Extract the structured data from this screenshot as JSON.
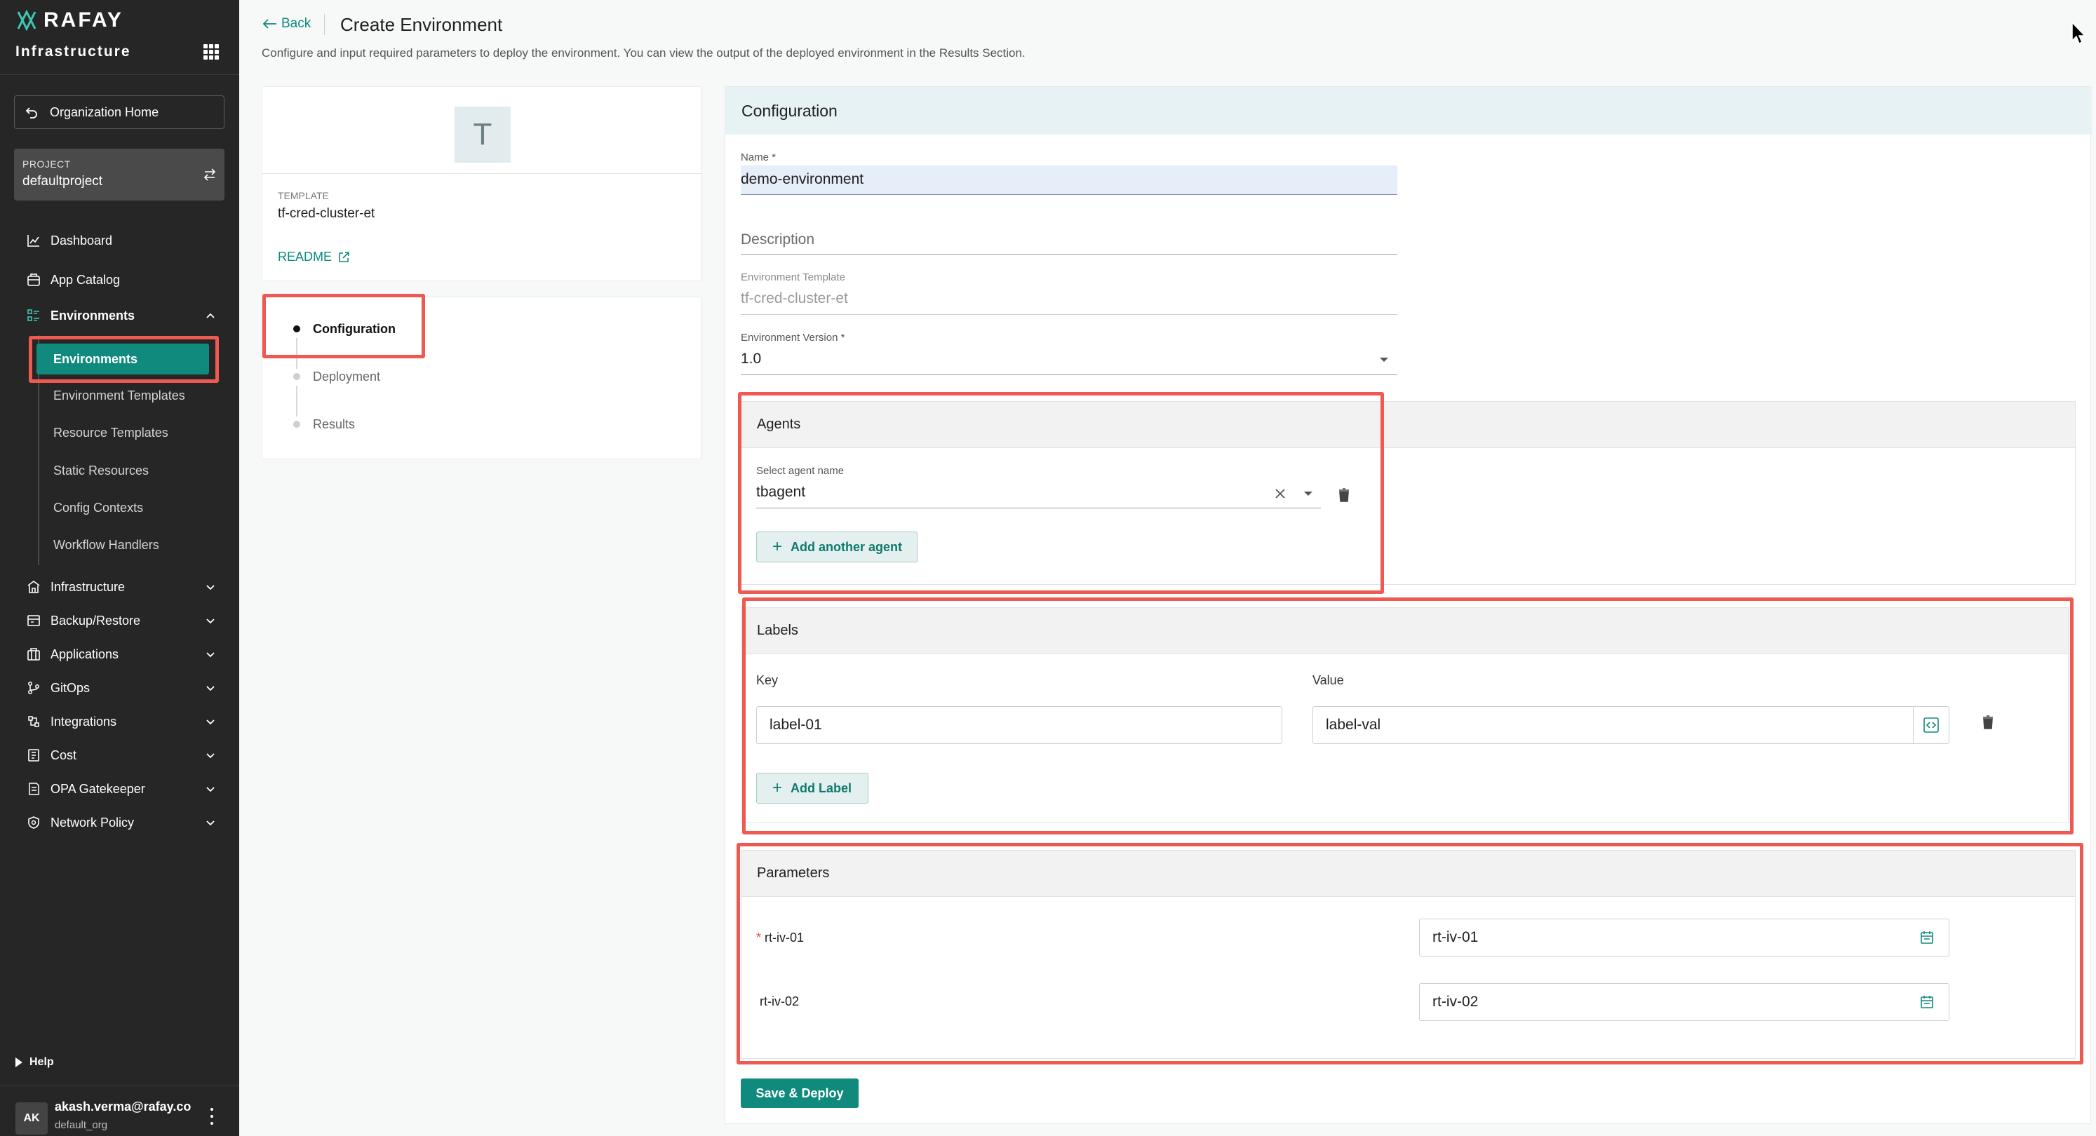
{
  "brand": {
    "name": "RAFAY",
    "section": "Infrastructure"
  },
  "sidebar": {
    "org_home": "Organization Home",
    "project": {
      "kicker": "PROJECT",
      "name": "defaultproject"
    },
    "nav": [
      {
        "label": "Dashboard",
        "icon": "chart-icon"
      },
      {
        "label": "App Catalog",
        "icon": "catalog-icon"
      },
      {
        "label": "Environments",
        "icon": "environments-icon"
      },
      {
        "label": "Infrastructure",
        "icon": "infrastructure-icon"
      },
      {
        "label": "Backup/Restore",
        "icon": "backup-icon"
      },
      {
        "label": "Applications",
        "icon": "applications-icon"
      },
      {
        "label": "GitOps",
        "icon": "gitops-icon"
      },
      {
        "label": "Integrations",
        "icon": "integrations-icon"
      },
      {
        "label": "Cost",
        "icon": "cost-icon"
      },
      {
        "label": "OPA Gatekeeper",
        "icon": "opa-icon"
      },
      {
        "label": "Network Policy",
        "icon": "network-policy-icon"
      }
    ],
    "env_sub": [
      "Environments",
      "Environment Templates",
      "Resource Templates",
      "Static Resources",
      "Config Contexts",
      "Workflow Handlers"
    ],
    "help": "Help",
    "user": {
      "initials": "AK",
      "email": "akash.verma@rafay.co",
      "org": "default_org"
    }
  },
  "header": {
    "back": "Back",
    "title": "Create Environment",
    "description": "Configure and input required parameters to deploy the environment. You can view the output of the deployed environment in the Results Section."
  },
  "template_card": {
    "letter": "T",
    "kicker": "TEMPLATE",
    "name": "tf-cred-cluster-et",
    "readme": "README"
  },
  "steps": [
    "Configuration",
    "Deployment",
    "Results"
  ],
  "config": {
    "heading": "Configuration",
    "name_label": "Name *",
    "name_value": "demo-environment",
    "description_placeholder": "Description",
    "template_label": "Environment Template",
    "template_value": "tf-cred-cluster-et",
    "version_label": "Environment Version *",
    "version_value": "1.0"
  },
  "agents": {
    "heading": "Agents",
    "select_label": "Select agent name",
    "value": "tbagent",
    "add_label": "Add another agent"
  },
  "labels": {
    "heading": "Labels",
    "key_header": "Key",
    "value_header": "Value",
    "key": "label-01",
    "value": "label-val",
    "add_label": "Add Label"
  },
  "parameters": {
    "heading": "Parameters",
    "rows": [
      {
        "name": "rt-iv-01",
        "required_mark": "*",
        "value": "rt-iv-01"
      },
      {
        "name": "rt-iv-02",
        "required_mark": "",
        "value": "rt-iv-02"
      }
    ]
  },
  "actions": {
    "save_deploy": "Save & Deploy"
  },
  "colors": {
    "accent": "#0f8a7d",
    "highlight": "#ee5a52",
    "sidebar": "#262626"
  }
}
